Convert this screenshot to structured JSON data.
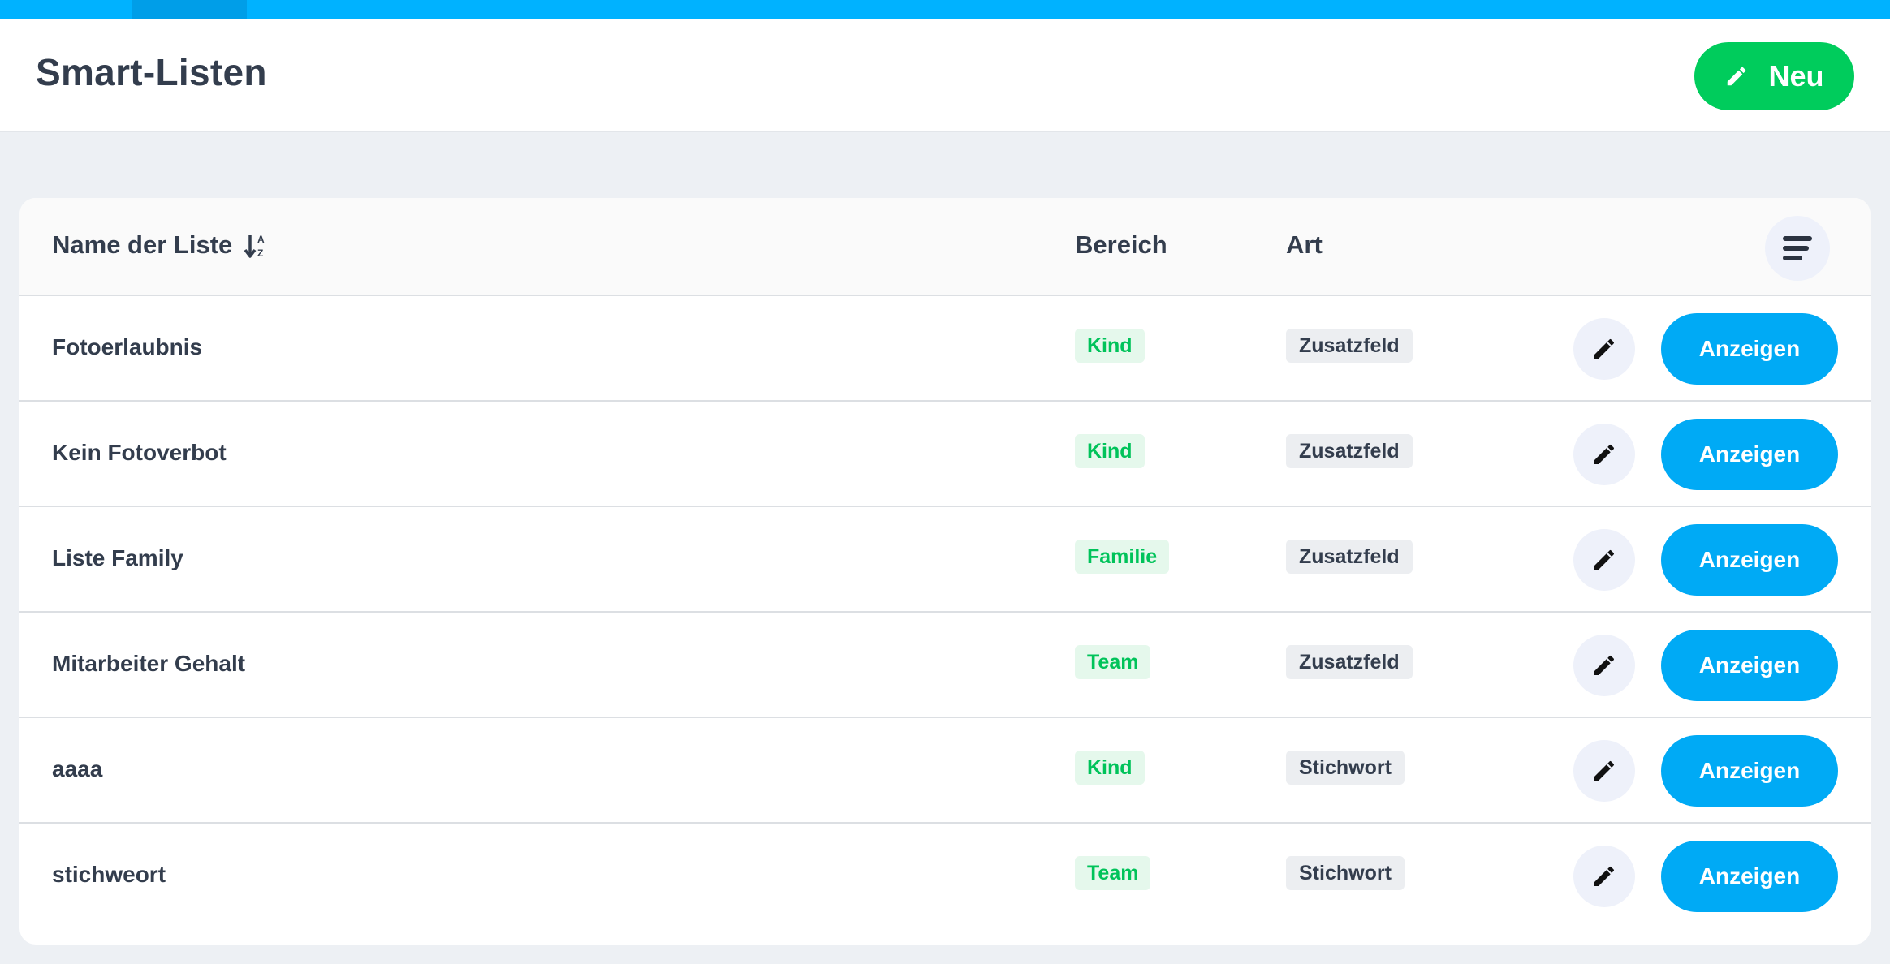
{
  "header": {
    "title": "Smart-Listen",
    "new_button_label": "Neu"
  },
  "table": {
    "columns": {
      "name": "Name der Liste",
      "bereich": "Bereich",
      "art": "Art"
    },
    "sort_icon": "sort-alpha-down-icon",
    "rows": [
      {
        "name": "Fotoerlaubnis",
        "bereich": "Kind",
        "art": "Zusatzfeld",
        "action_label": "Anzeigen"
      },
      {
        "name": "Kein Fotoverbot",
        "bereich": "Kind",
        "art": "Zusatzfeld",
        "action_label": "Anzeigen"
      },
      {
        "name": "Liste Family",
        "bereich": "Familie",
        "art": "Zusatzfeld",
        "action_label": "Anzeigen"
      },
      {
        "name": "Mitarbeiter Gehalt",
        "bereich": "Team",
        "art": "Zusatzfeld",
        "action_label": "Anzeigen"
      },
      {
        "name": "aaaa",
        "bereich": "Kind",
        "art": "Stichwort",
        "action_label": "Anzeigen"
      },
      {
        "name": "stichweort",
        "bereich": "Team",
        "art": "Stichwort",
        "action_label": "Anzeigen"
      }
    ]
  },
  "colors": {
    "accent_blue": "#00aaf5",
    "accent_green": "#00cc5c",
    "badge_green_text": "#00c35a"
  }
}
